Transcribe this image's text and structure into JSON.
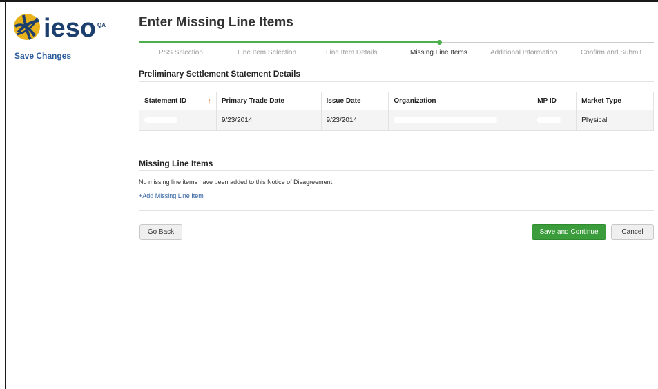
{
  "app": {
    "logo_text": "ieso",
    "env_badge": "QA",
    "save_changes_label": "Save Changes"
  },
  "page": {
    "title": "Enter Missing Line Items"
  },
  "steps": [
    {
      "label": "PSS Selection",
      "state": "complete"
    },
    {
      "label": "Line Item Selection",
      "state": "complete"
    },
    {
      "label": "Line Item Details",
      "state": "complete"
    },
    {
      "label": "Missing Line Items",
      "state": "current"
    },
    {
      "label": "Additional Information",
      "state": "upcoming"
    },
    {
      "label": "Confirm and Submit",
      "state": "upcoming"
    }
  ],
  "pss": {
    "title": "Preliminary Settlement Statement Details",
    "columns": [
      "Statement ID",
      "Primary Trade Date",
      "Issue Date",
      "Organization",
      "MP ID",
      "Market Type"
    ],
    "sort_icon": "sort-ascending-icon",
    "row": {
      "statement_id": "",
      "primary_trade_date": "9/23/2014",
      "issue_date": "9/23/2014",
      "organization": "",
      "mp_id": "",
      "market_type": "Physical"
    }
  },
  "missing": {
    "title": "Missing Line Items",
    "message": "No missing line items have been added to this Notice of Disagreement.",
    "add_link": "+Add Missing Line Item"
  },
  "buttons": {
    "go_back": "Go Back",
    "save_continue": "Save and Continue",
    "cancel": "Cancel"
  },
  "colors": {
    "brand": "#1d3f6e",
    "logo_globe": "#e8b21c",
    "progress": "#4cae4c",
    "primary_button": "#3a9c3a",
    "link": "#2b5c9e",
    "sort_icon": "#e07b2a"
  }
}
